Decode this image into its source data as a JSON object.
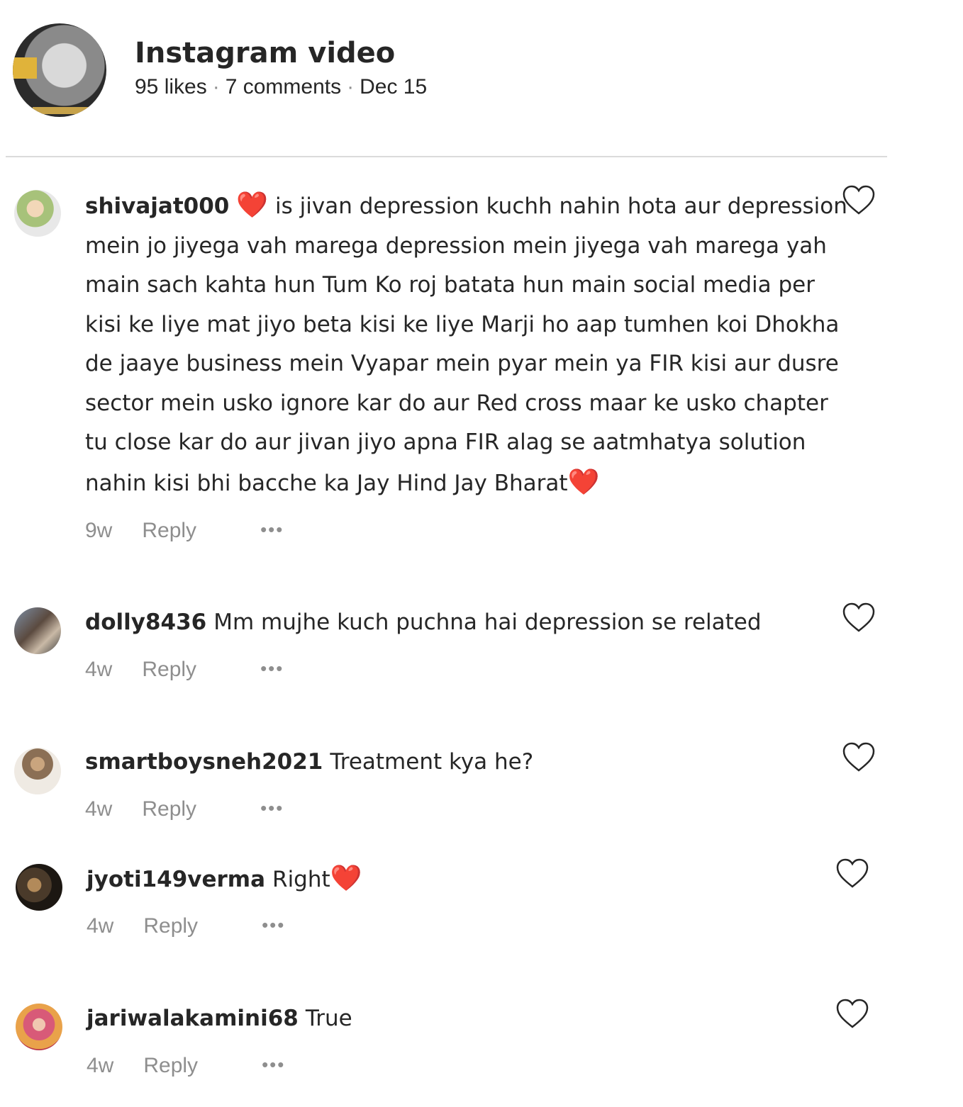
{
  "post": {
    "title": "Instagram video",
    "likes": "95 likes",
    "comments": "7 comments",
    "date": "Dec 15"
  },
  "comments": [
    {
      "username": "shivajat000",
      "text_before_emoji": "",
      "lead_emoji": "❤️",
      "text": " is jivan depression kuchh nahin hota aur depression mein jo jiyega vah marega depression mein jiyega vah marega yah main sach kahta hun Tum Ko roj batata hun main social media per kisi ke liye mat jiyo beta kisi ke liye Marji ho aap tumhen koi Dhokha de jaaye business mein Vyapar mein pyar mein ya FIR kisi aur dusre sector mein usko ignore kar do aur Red cross maar ke usko chapter tu close kar do aur jivan jiyo apna FIR alag se aatmhatya solution nahin kisi bhi bacche ka Jay Hind Jay Bharat",
      "trail_emoji": "❤️",
      "time": "9w",
      "reply": "Reply",
      "more": "•••"
    },
    {
      "username": "dolly8436",
      "text": "Mm mujhe kuch puchna hai depression se related",
      "time": "4w",
      "reply": "Reply",
      "more": "•••"
    },
    {
      "username": "smartboysneh2021",
      "text": "Treatment kya he?",
      "time": "4w",
      "reply": "Reply",
      "more": "•••"
    },
    {
      "username": "jyoti149verma",
      "text": "Right",
      "trail_emoji": "❤️",
      "time": "4w",
      "reply": "Reply",
      "more": "•••"
    },
    {
      "username": "jariwalakamini68",
      "text": "True",
      "time": "4w",
      "reply": "Reply",
      "more": "•••"
    }
  ],
  "icons": {
    "like": "heart-outline-icon",
    "emoji_heart": "red-heart-emoji"
  }
}
